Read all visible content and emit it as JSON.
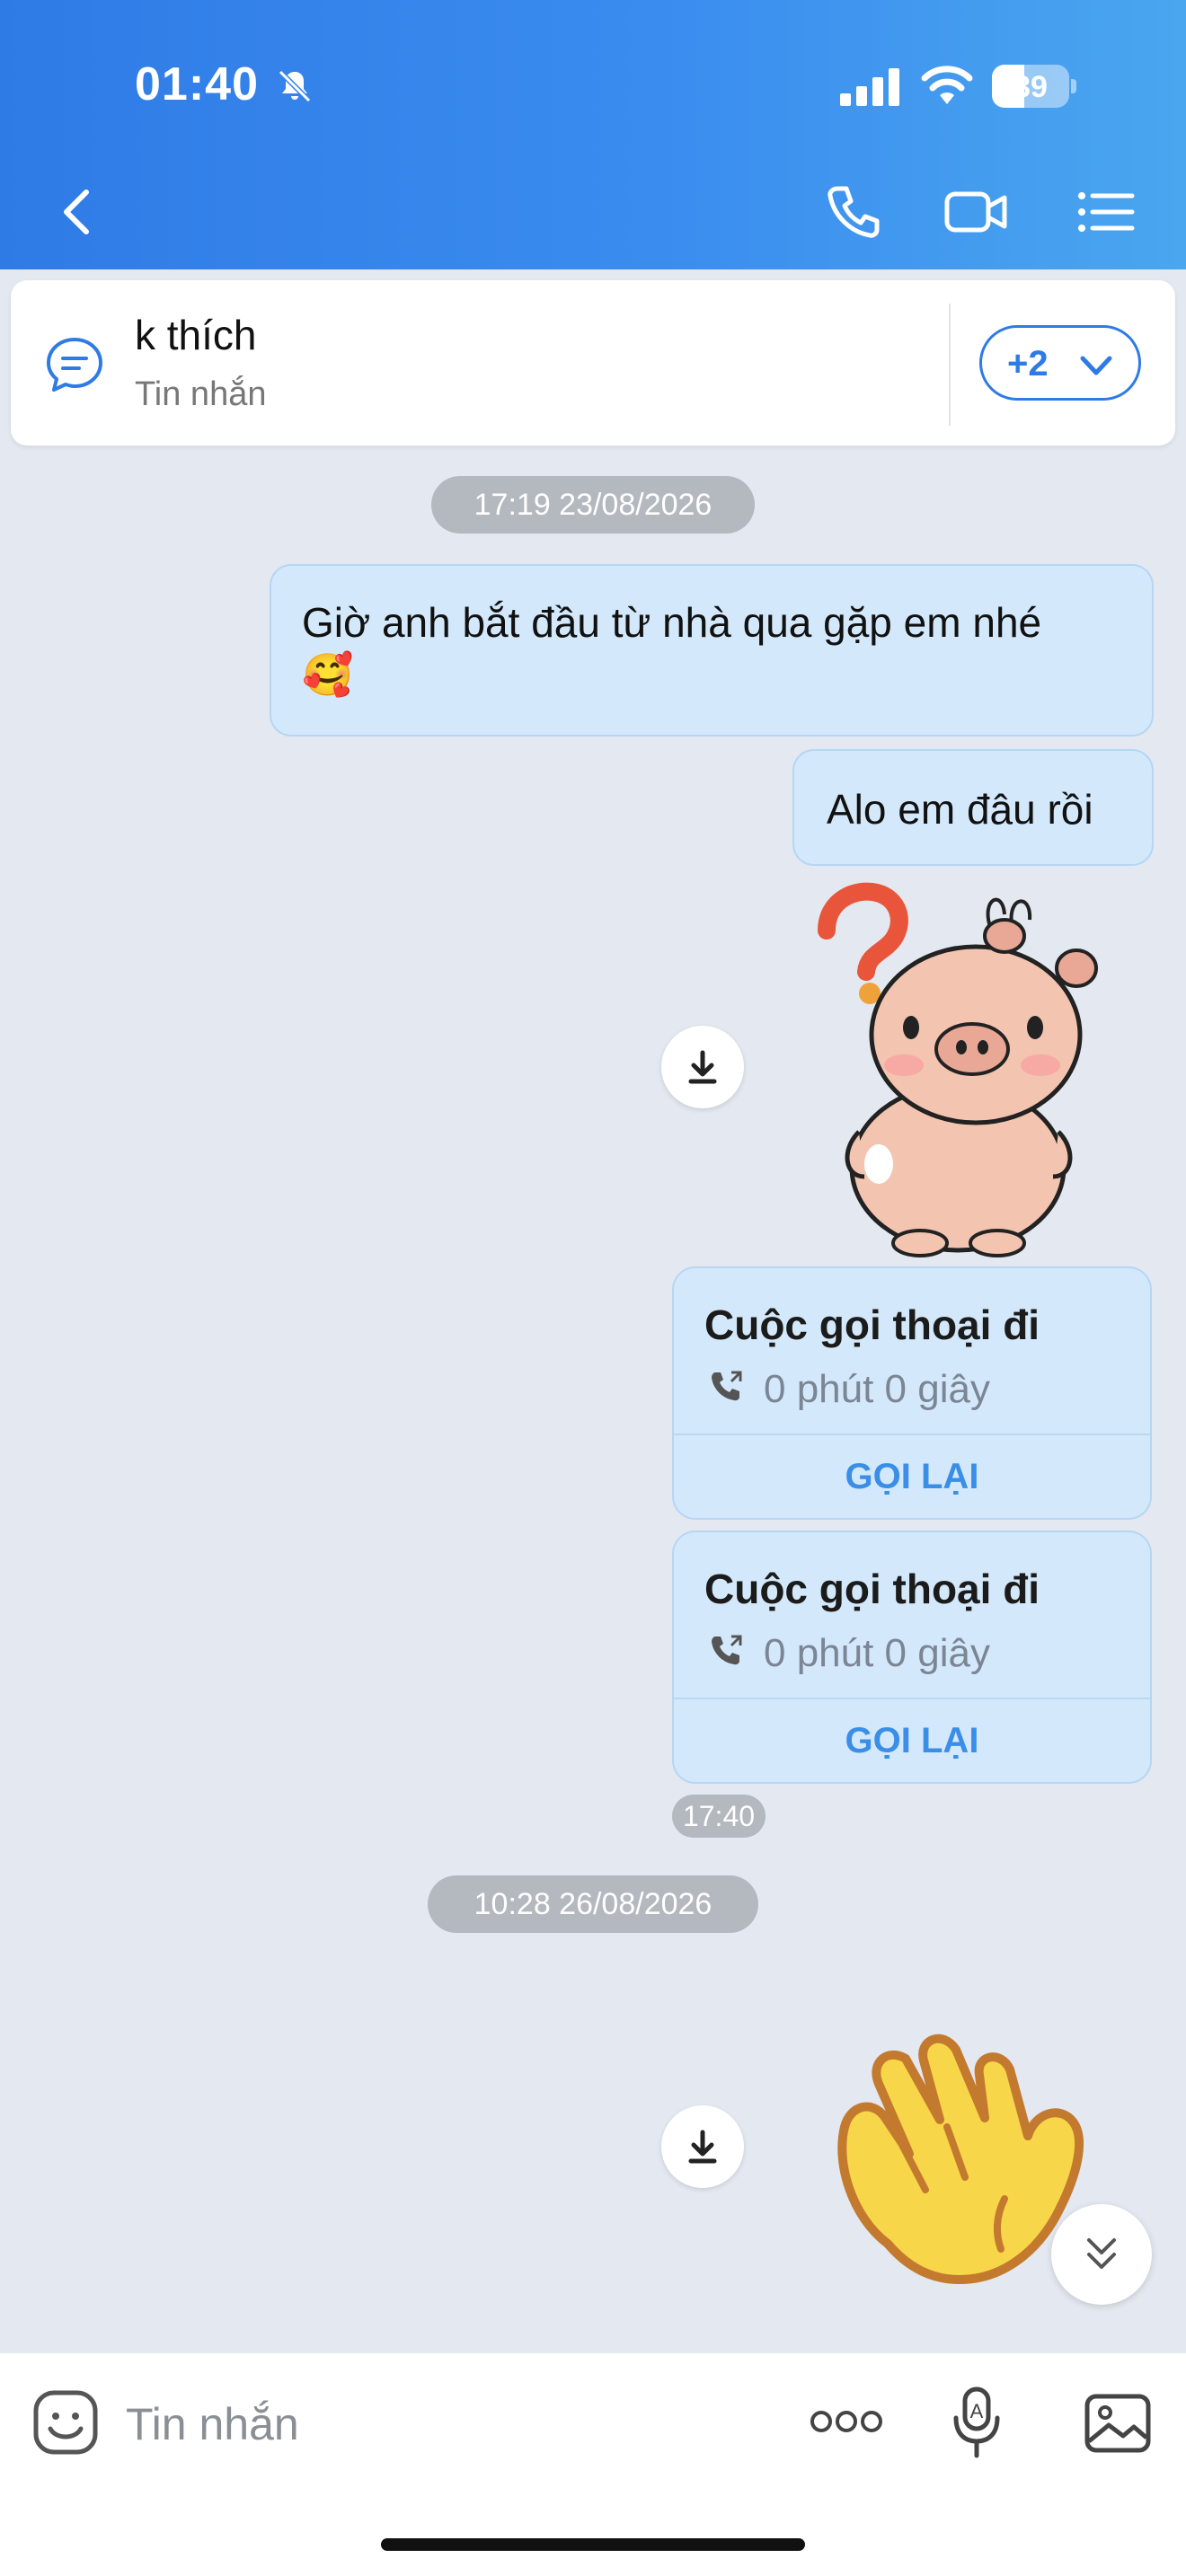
{
  "status_bar": {
    "time": "01:40",
    "battery": "39",
    "icons": [
      "bell-off-icon",
      "cellular-signal-icon",
      "wifi-icon",
      "battery-icon"
    ]
  },
  "header": {
    "icons": [
      "back-icon",
      "phone-icon",
      "video-call-icon",
      "menu-list-icon"
    ],
    "accent": "#2f7be6"
  },
  "pinned": {
    "title": "k thích",
    "subtitle": "Tin nhắn",
    "more": "+2"
  },
  "chat": {
    "date1": "17:19 23/08/2026",
    "messages": [
      {
        "text": "Giờ anh bắt đầu từ nhà qua gặp em nhé",
        "emoji": "🥰"
      },
      {
        "text": "Alo em đâu rồi"
      }
    ],
    "calls": [
      {
        "title": "Cuộc gọi thoại đi",
        "duration": "0 phút 0 giây",
        "action": "GỌI LẠI"
      },
      {
        "title": "Cuộc gọi thoại đi",
        "duration": "0 phút 0 giây",
        "action": "GỌI LẠI"
      }
    ],
    "time_stamp": "17:40",
    "date2": "10:28 26/08/2026",
    "bubble_color": "#d3e9fb"
  },
  "composer": {
    "placeholder": "Tin nhắn",
    "value": "",
    "icons": [
      "emoji-icon",
      "more-dots-icon",
      "voice-icon",
      "image-icon"
    ]
  }
}
